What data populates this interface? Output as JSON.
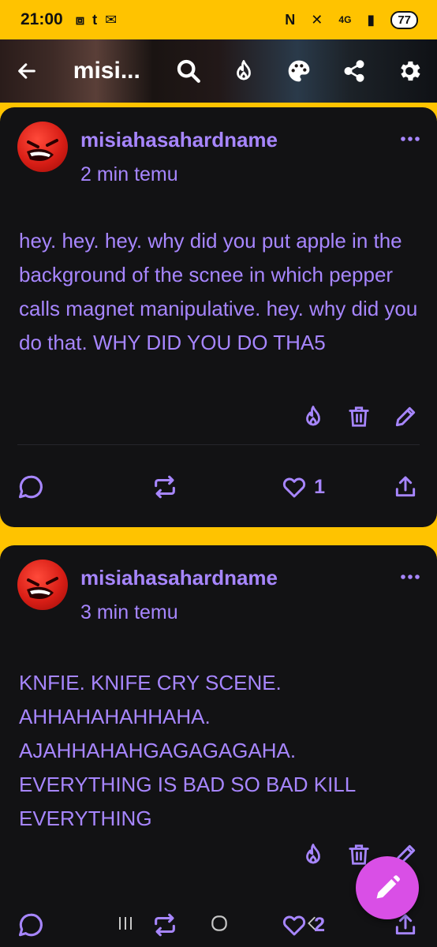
{
  "status_bar": {
    "time": "21:00",
    "network": "4G",
    "battery": "77"
  },
  "appbar": {
    "title": "misi...",
    "back_icon": "arrow-left-icon",
    "actions": [
      "search-icon",
      "flame-icon",
      "palette-icon",
      "share-icon",
      "gear-icon"
    ]
  },
  "posts": [
    {
      "username": "misiahasahardname",
      "time": "2 min temu",
      "body": "hey. hey. hey. why did you put apple in the background of the scnee  in which pepper calls magnet manipulative. hey. why did you do that. WHY DID YOU DO THA5",
      "likes": "1"
    },
    {
      "username": "misiahasahardname",
      "time": "3 min temu",
      "body": "KNFIE. KNIFE CRY SCENE. AHHAHAHAHHAHA. AJAHHAHAHGAGAGAGAHA. EVERYTHING IS BAD SO BAD KILL EVERYTHING",
      "likes": "2"
    }
  ],
  "colors": {
    "accent": "#a786ff",
    "background": "#ffc300",
    "card": "#121214",
    "fab": "#d94fe6"
  }
}
